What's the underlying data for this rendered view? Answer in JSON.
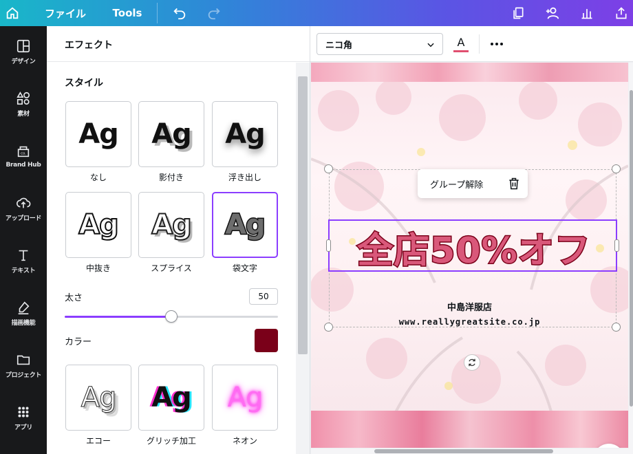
{
  "topbar": {
    "file_label": "ファイル",
    "tools_label": "Tools"
  },
  "rail": {
    "items": [
      {
        "label": "デザイン",
        "icon": "layout-icon"
      },
      {
        "label": "素材",
        "icon": "shapes-icon"
      },
      {
        "label": "Brand Hub",
        "icon": "brand-hub-icon"
      },
      {
        "label": "アップロード",
        "icon": "upload-cloud-icon"
      },
      {
        "label": "テキスト",
        "icon": "text-icon"
      },
      {
        "label": "描画機能",
        "icon": "draw-icon"
      },
      {
        "label": "プロジェクト",
        "icon": "folder-icon"
      },
      {
        "label": "アプリ",
        "icon": "apps-grid-icon"
      }
    ]
  },
  "panel": {
    "title": "エフェクト",
    "style_section": "スタイル",
    "tile_text": "Ag",
    "styles": [
      {
        "label": "なし"
      },
      {
        "label": "影付き"
      },
      {
        "label": "浮き出し"
      },
      {
        "label": "中抜き"
      },
      {
        "label": "スプライス"
      },
      {
        "label": "袋文字"
      },
      {
        "label": "エコー"
      },
      {
        "label": "グリッチ加工"
      },
      {
        "label": "ネオン"
      }
    ],
    "selected_style": "袋文字",
    "thickness_label": "太さ",
    "thickness_value": "50",
    "thickness_fraction": 0.5,
    "color_label": "カラー",
    "color_value": "#7a0019"
  },
  "canvas": {
    "font_name": "ニコ角",
    "text_color": "#e04f6f",
    "group_popup_label": "グループ解除",
    "headline": "全店50%オフ",
    "shop_name": "中島洋服店",
    "shop_url": "www.reallygreatsite.co.jp"
  }
}
